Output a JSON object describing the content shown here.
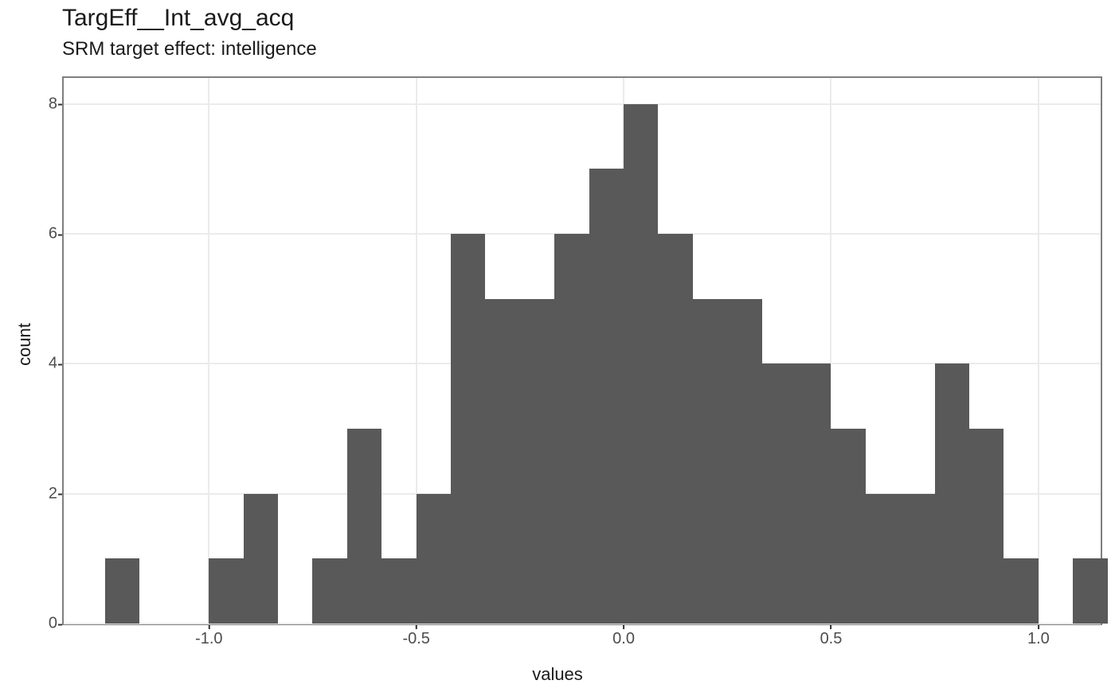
{
  "chart_data": {
    "type": "bar",
    "title": "TargEff__Int_avg_acq",
    "subtitle": "SRM target effect: intelligence",
    "xlabel": "values",
    "ylabel": "count",
    "xlim": [
      -1.35,
      1.15
    ],
    "ylim": [
      0,
      8.4
    ],
    "x_ticks": [
      -1.0,
      -0.5,
      0.0,
      0.5,
      1.0
    ],
    "y_ticks": [
      0,
      2,
      4,
      6,
      8
    ],
    "bin_width": 0.0833333,
    "bins": [
      {
        "center": -1.2083,
        "count": 1
      },
      {
        "center": -1.125,
        "count": 0
      },
      {
        "center": -1.0417,
        "count": 0
      },
      {
        "center": -0.9583,
        "count": 1
      },
      {
        "center": -0.875,
        "count": 2
      },
      {
        "center": -0.7917,
        "count": 0
      },
      {
        "center": -0.7083,
        "count": 1
      },
      {
        "center": -0.625,
        "count": 3
      },
      {
        "center": -0.5417,
        "count": 1
      },
      {
        "center": -0.4583,
        "count": 2
      },
      {
        "center": -0.375,
        "count": 6
      },
      {
        "center": -0.2917,
        "count": 5
      },
      {
        "center": -0.2083,
        "count": 5
      },
      {
        "center": -0.125,
        "count": 6
      },
      {
        "center": -0.0417,
        "count": 7
      },
      {
        "center": 0.0417,
        "count": 8
      },
      {
        "center": 0.125,
        "count": 6
      },
      {
        "center": 0.2083,
        "count": 5
      },
      {
        "center": 0.2917,
        "count": 5
      },
      {
        "center": 0.375,
        "count": 4
      },
      {
        "center": 0.4583,
        "count": 4
      },
      {
        "center": 0.5417,
        "count": 3
      },
      {
        "center": 0.625,
        "count": 2
      },
      {
        "center": 0.7083,
        "count": 2
      },
      {
        "center": 0.7917,
        "count": 4
      },
      {
        "center": 0.875,
        "count": 3
      },
      {
        "center": 0.9583,
        "count": 1
      },
      {
        "center": 1.0417,
        "count": 0
      },
      {
        "center": 1.125,
        "count": 1
      }
    ]
  },
  "colors": {
    "bar_fill": "#595959",
    "grid": "#ebebeb",
    "panel_border": "#7f7f7f",
    "text": "#1a1a1a",
    "tick_text": "#4d4d4d"
  }
}
